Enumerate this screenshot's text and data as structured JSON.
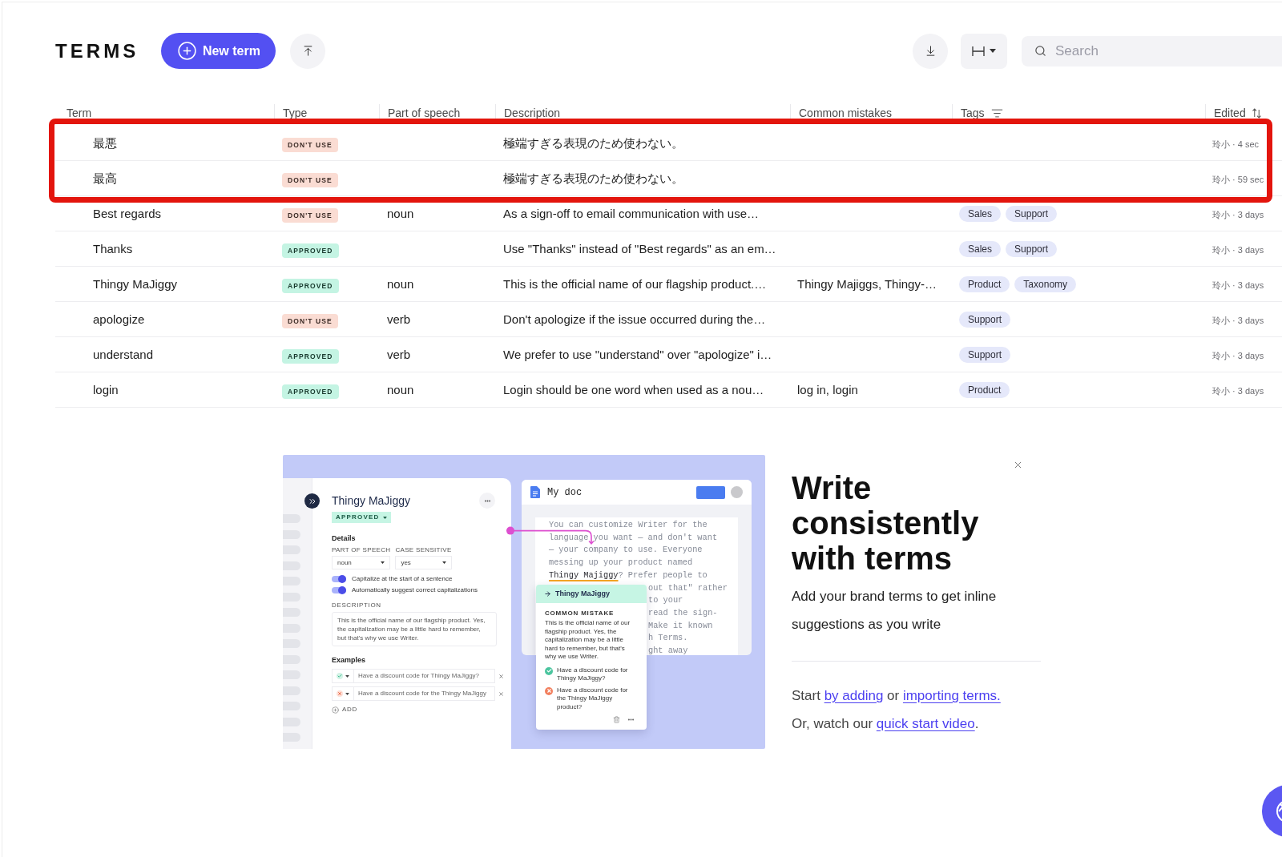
{
  "header": {
    "title": "TERMS",
    "new_term_button": "New term",
    "search": {
      "placeholder": "Search"
    }
  },
  "table": {
    "columns": [
      {
        "label": "Term",
        "kind": "plain"
      },
      {
        "label": "Type",
        "kind": "plain"
      },
      {
        "label": "Part of speech",
        "kind": "plain"
      },
      {
        "label": "Description",
        "kind": "plain"
      },
      {
        "label": "Common mistakes",
        "kind": "plain"
      },
      {
        "label": "Tags",
        "kind": "filter"
      },
      {
        "label": "Edited",
        "kind": "sort"
      }
    ],
    "rows": [
      {
        "term": "最悪",
        "type": {
          "label": "DON'T USE",
          "kind": "dont_use"
        },
        "description": "極端すぎる表現のため使わない。",
        "edited": "玲小 · 4 sec",
        "highlighted": true
      },
      {
        "term": "最高",
        "type": {
          "label": "DON'T USE",
          "kind": "dont_use"
        },
        "description": "極端すぎる表現のため使わない。",
        "edited": "玲小 · 59 sec",
        "highlighted": true
      },
      {
        "term": "Best regards",
        "type": {
          "label": "DON'T USE",
          "kind": "dont_use"
        },
        "part_of_speech": "noun",
        "description": "As a sign-off to email communication with use…",
        "tags": [
          "Sales",
          "Support"
        ],
        "edited": "玲小 · 3 days",
        "highlighted": false
      },
      {
        "term": "Thanks",
        "type": {
          "label": "APPROVED",
          "kind": "approved"
        },
        "description": "Use \"Thanks\" instead of \"Best regards\" as an em…",
        "tags": [
          "Sales",
          "Support"
        ],
        "edited": "玲小 · 3 days",
        "highlighted": false
      },
      {
        "term": "Thingy MaJiggy",
        "type": {
          "label": "APPROVED",
          "kind": "approved"
        },
        "part_of_speech": "noun",
        "description": "This is the official name of our flagship product.…",
        "common_mistakes": "Thingy Majiggs, Thingy-…",
        "tags": [
          "Product",
          "Taxonomy"
        ],
        "edited": "玲小 · 3 days",
        "highlighted": false
      },
      {
        "term": "apologize",
        "type": {
          "label": "DON'T USE",
          "kind": "dont_use"
        },
        "part_of_speech": "verb",
        "description": "Don't apologize if the issue occurred during the…",
        "tags": [
          "Support"
        ],
        "edited": "玲小 · 3 days",
        "highlighted": false
      },
      {
        "term": "understand",
        "type": {
          "label": "APPROVED",
          "kind": "approved"
        },
        "part_of_speech": "verb",
        "description": "We prefer to use \"understand\" over \"apologize\" i…",
        "tags": [
          "Support"
        ],
        "edited": "玲小 · 3 days",
        "highlighted": false
      },
      {
        "term": "login",
        "type": {
          "label": "APPROVED",
          "kind": "approved"
        },
        "part_of_speech": "noun",
        "description": "Login should be one word when used as a nou…",
        "common_mistakes": "log in, login",
        "tags": [
          "Product"
        ],
        "edited": "玲小 · 3 days",
        "highlighted": false
      }
    ]
  },
  "illustration": {
    "editor": {
      "title": "Thingy MaJiggy",
      "status": "APPROVED",
      "details_heading": "Details",
      "fields": [
        {
          "label": "PART OF SPEECH",
          "value": "noun"
        },
        {
          "label": "CASE SENSITIVE",
          "value": "yes"
        }
      ],
      "toggles": [
        {
          "label": "Capitalize at the start of a sentence",
          "on": true
        },
        {
          "label": "Automatically suggest correct capitalizations",
          "on": true
        }
      ],
      "description_label": "DESCRIPTION",
      "description": "This is the official name of our flagship product. Yes, the capitalization may be a little hard to remember, but that's why we use Writer.",
      "examples_heading": "Examples",
      "examples": [
        {
          "text": "Have a discount code for Thingy MaJiggy?",
          "kind": "correct"
        },
        {
          "text": "Have a discount code for the Thingy MaJiggy",
          "kind": "incorrect"
        }
      ],
      "add_label": "ADD"
    },
    "document": {
      "title": "My doc",
      "lines": [
        {
          "kind": "plain",
          "text": "You can customize Writer for the"
        },
        {
          "kind": "plain",
          "text": "language you want — and don't want"
        },
        {
          "kind": "plain",
          "text": "— your company to use. Everyone"
        },
        {
          "kind": "plain",
          "text": "messing up your product named"
        },
        {
          "kind": "term",
          "term": "Thingy Majiggy",
          "text": "? Prefer people to"
        },
        {
          "kind": "tail",
          "text": "out that\" rather"
        },
        {
          "kind": "tail",
          "text": "to your"
        },
        {
          "kind": "tail",
          "text": "read the sign-"
        },
        {
          "kind": "tail",
          "text": "Make it known"
        },
        {
          "kind": "tail",
          "text": "h Terms."
        },
        {
          "kind": "tail",
          "text": "ght away"
        }
      ]
    },
    "suggestion": {
      "term": "Thingy MaJiggy",
      "heading": "COMMON MISTAKE",
      "text": "This is the official name of our flagship product. Yes, the capitalization may be a little hard to remember, but that's why we use Writer.",
      "examples": [
        {
          "text": "Have a discount code for Thingy MaJiggy?",
          "kind": "correct"
        },
        {
          "text": "Have a discount code for the Thingy MaJiggy product?",
          "kind": "incorrect"
        }
      ]
    }
  },
  "promo": {
    "title": "Write consistently with terms",
    "subtitle": "Add your brand terms to get inline suggestions as you write",
    "cta_lines": [
      [
        {
          "kind": "text",
          "text": "Start "
        },
        {
          "kind": "link",
          "text": "by adding"
        },
        {
          "kind": "text",
          "text": " or "
        },
        {
          "kind": "link",
          "text": "importing terms."
        }
      ],
      [
        {
          "kind": "text",
          "text": "Or, watch our "
        },
        {
          "kind": "link",
          "text": "quick start video"
        },
        {
          "kind": "text",
          "text": "."
        }
      ]
    ]
  }
}
